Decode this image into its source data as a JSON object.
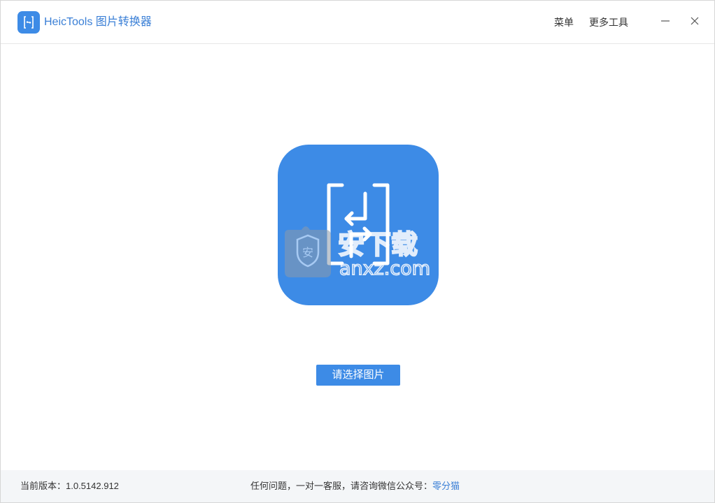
{
  "window": {
    "title": "HeicTools 图片转换器",
    "menu_label": "菜单",
    "more_tools_label": "更多工具"
  },
  "main": {
    "select_button_label": "请选择图片"
  },
  "footer": {
    "version_text": "当前版本：1.0.5142.912",
    "contact_text": "任何问题，一对一客服，请咨询微信公众号：",
    "contact_link": "零分猫"
  },
  "watermark": {
    "brand": "安下载",
    "domain": "anxz.com"
  },
  "colors": {
    "brand_blue": "#3d8be6",
    "title_blue": "#3a7fd6",
    "footer_bg": "#f4f6f8"
  },
  "icons": {
    "app_logo": "heictools-logo-icon",
    "hero": "image-convert-icon",
    "minimize": "minimize-icon",
    "close": "close-icon"
  }
}
